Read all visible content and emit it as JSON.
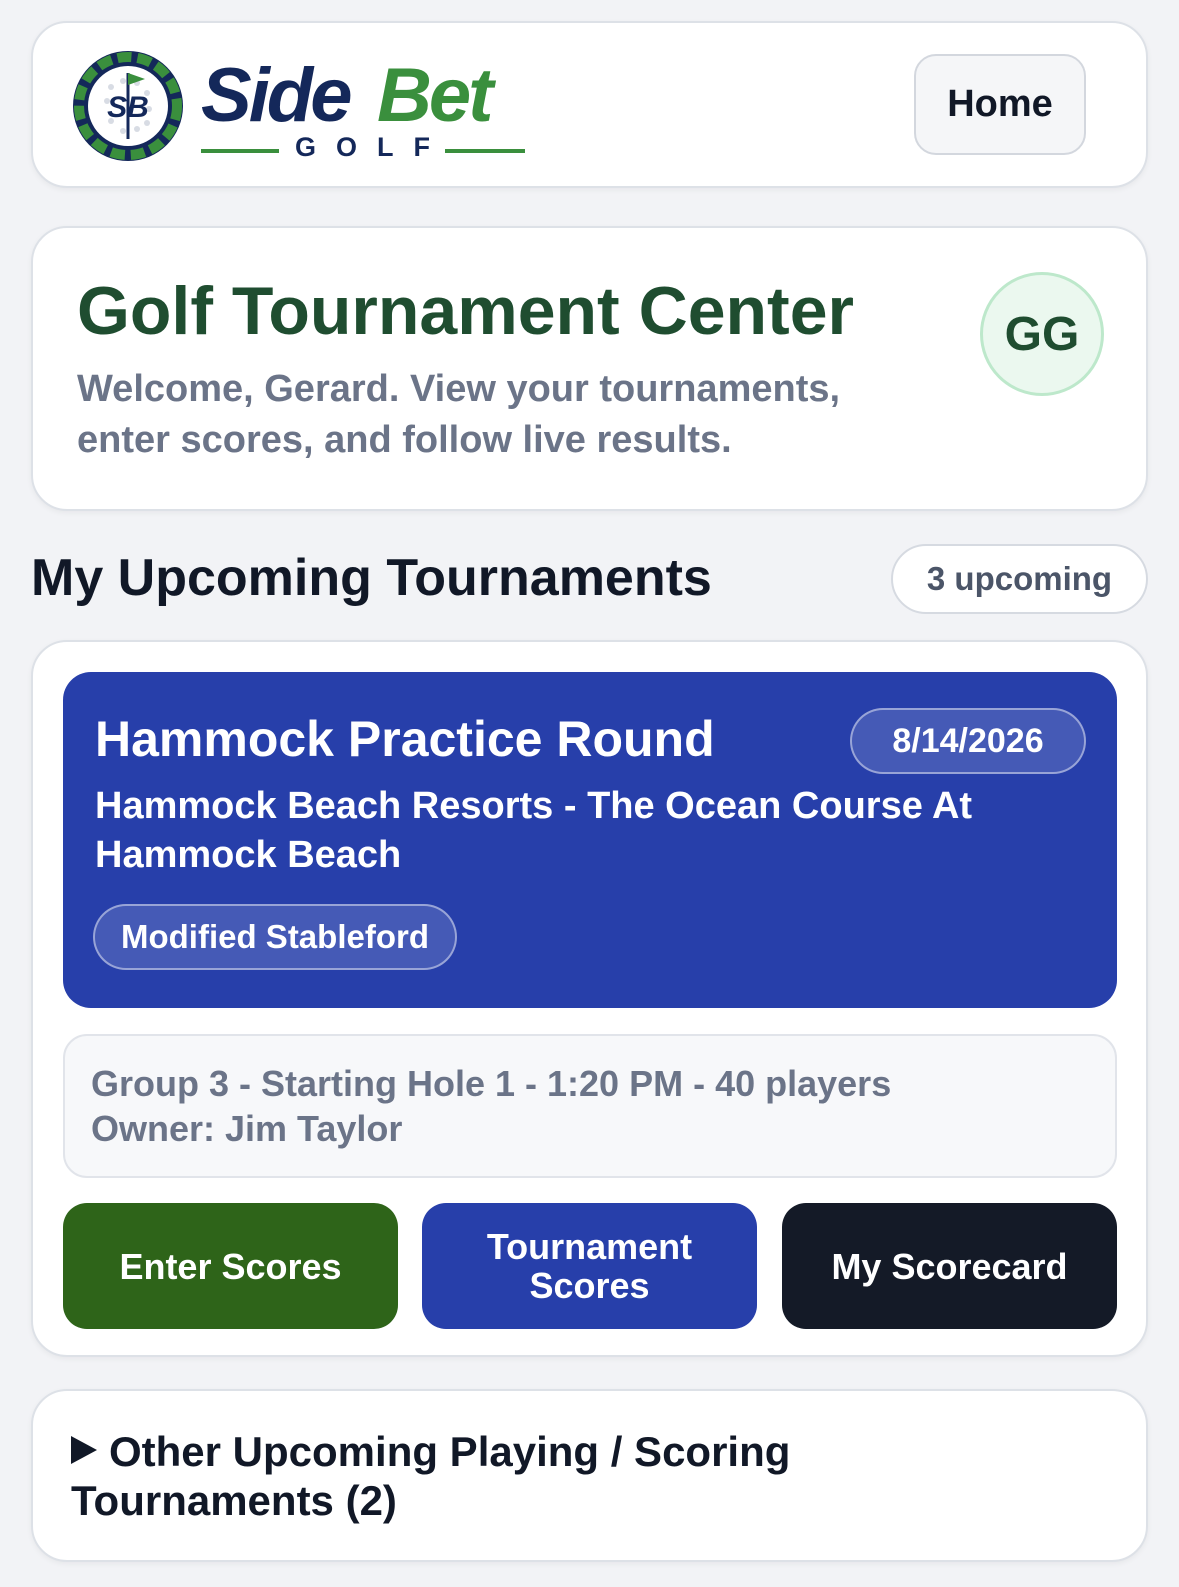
{
  "header": {
    "logo": {
      "badge_text": "SB",
      "word_side": "Side",
      "word_bet": "Bet",
      "word_golf": "GOLF"
    },
    "home_label": "Home"
  },
  "welcome": {
    "title": "Golf Tournament Center",
    "text": "Welcome, Gerard. View your tournaments, enter scores, and follow live results.",
    "avatar_initials": "GG"
  },
  "upcoming": {
    "title": "My Upcoming Tournaments",
    "count_label": "3 upcoming"
  },
  "tournament": {
    "name": "Hammock Practice Round",
    "date": "8/14/2026",
    "course": "Hammock Beach Resorts - The Ocean Course At Hammock Beach",
    "format": "Modified Stableford",
    "details_line1": "Group 3 - Starting Hole 1 - 1:20 PM - 40 players",
    "details_line2": "Owner: Jim Taylor",
    "buttons": {
      "enter_scores": "Enter Scores",
      "tournament_scores": "Tournament Scores",
      "my_scorecard": "My Scorecard"
    }
  },
  "other": {
    "label": "Other Upcoming Playing / Scoring Tournaments (2)",
    "expand_icon": "triangle-right-icon"
  },
  "colors": {
    "background": "#f2f3f6",
    "brand_navy": "#14285a",
    "brand_green": "#3a8f3d",
    "title_green": "#1f4d30",
    "banner_blue": "#273faa",
    "enter_green": "#2e6419",
    "dark_button": "#141a27"
  }
}
